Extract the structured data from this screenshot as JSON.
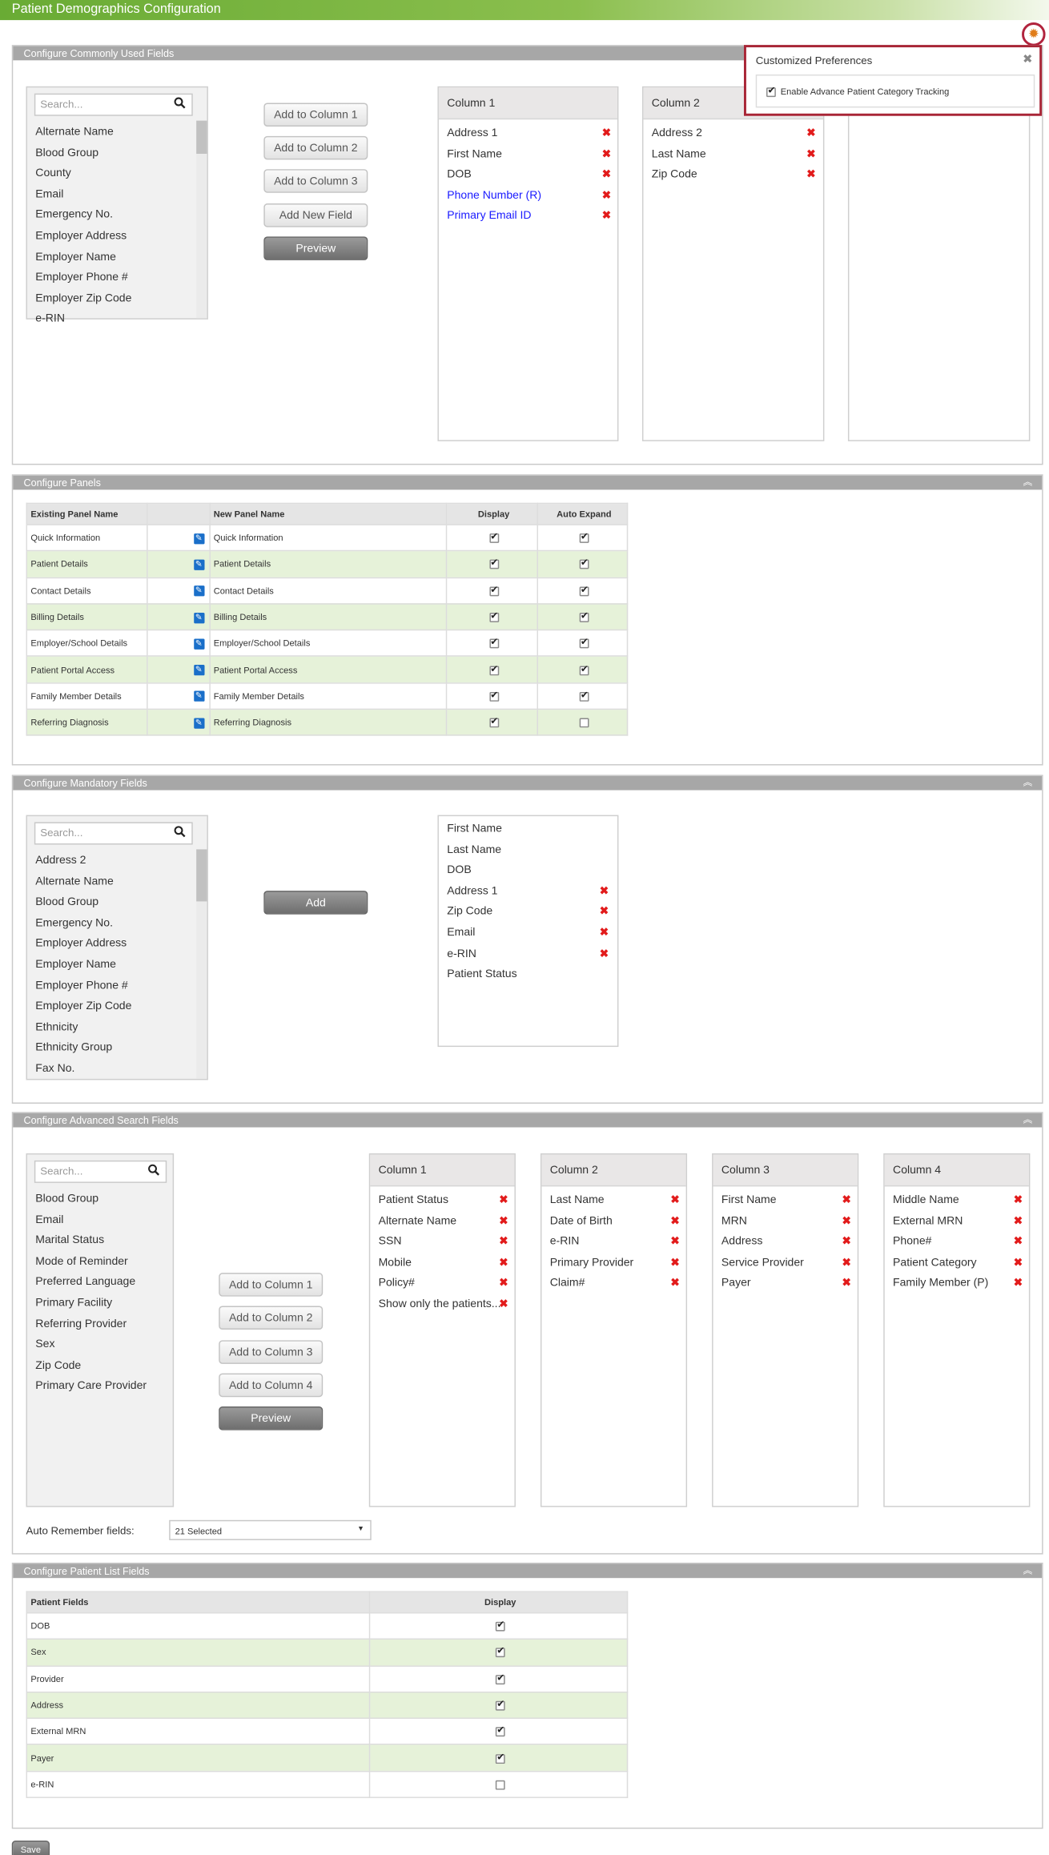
{
  "page_title": "Patient Demographics Configuration",
  "preferences": {
    "title": "Customized Preferences",
    "option": "Enable Advance Patient Category Tracking",
    "checked": true
  },
  "common": {
    "title": "Configure Commonly Used Fields",
    "search_placeholder": "Search...",
    "list": [
      "Alternate Name",
      "Blood Group",
      "County",
      "Email",
      "Emergency No.",
      "Employer Address",
      "Employer Name",
      "Employer Phone #",
      "Employer Zip Code",
      "e-RIN"
    ],
    "buttons": [
      "Add to Column 1",
      "Add to Column 2",
      "Add to Column 3",
      "Add New Field",
      "Preview"
    ],
    "col1": {
      "title": "Column 1",
      "items": [
        "Address 1",
        "First Name",
        "DOB",
        "Phone Number (R)",
        "Primary Email ID"
      ]
    },
    "col2": {
      "title": "Column 2",
      "items": [
        "Address 2",
        "Last Name",
        "Zip Code"
      ]
    }
  },
  "panels": {
    "title": "Configure Panels",
    "headers": [
      "Existing Panel Name",
      "New Panel Name",
      "Display",
      "Auto Expand"
    ],
    "rows": [
      {
        "existing": "Quick Information",
        "new": "Quick Information",
        "display": true,
        "auto": true
      },
      {
        "existing": "Patient Details",
        "new": "Patient Details",
        "display": true,
        "auto": true
      },
      {
        "existing": "Contact Details",
        "new": "Contact Details",
        "display": true,
        "auto": true
      },
      {
        "existing": "Billing Details",
        "new": "Billing Details",
        "display": true,
        "auto": true
      },
      {
        "existing": "Employer/School Details",
        "new": "Employer/School Details",
        "display": true,
        "auto": true
      },
      {
        "existing": "Patient Portal Access",
        "new": "Patient Portal Access",
        "display": true,
        "auto": true
      },
      {
        "existing": "Family Member Details",
        "new": "Family Member Details",
        "display": true,
        "auto": true
      },
      {
        "existing": "Referring Diagnosis",
        "new": "Referring Diagnosis",
        "display": true,
        "auto": false
      }
    ]
  },
  "mandatory": {
    "title": "Configure Mandatory Fields",
    "search_placeholder": "Search...",
    "list": [
      "Address 2",
      "Alternate Name",
      "Blood Group",
      "Emergency No.",
      "Employer Address",
      "Employer Name",
      "Employer Phone #",
      "Employer Zip Code",
      "Ethnicity",
      "Ethnicity Group",
      "Fax No."
    ],
    "add_label": "Add",
    "selected": [
      {
        "name": "First Name",
        "x": false
      },
      {
        "name": "Last Name",
        "x": false
      },
      {
        "name": "DOB",
        "x": false
      },
      {
        "name": "Address 1",
        "x": true
      },
      {
        "name": "Zip Code",
        "x": true
      },
      {
        "name": "Email",
        "x": true
      },
      {
        "name": "e-RIN",
        "x": true
      },
      {
        "name": "Patient Status",
        "x": false
      }
    ]
  },
  "advanced": {
    "title": "Configure Advanced Search Fields",
    "search_placeholder": "Search...",
    "list": [
      "Blood Group",
      "Email",
      "Marital Status",
      "Mode of Reminder",
      "Preferred Language",
      "Primary Facility",
      "Referring Provider",
      "Sex",
      "Zip Code",
      "Primary Care Provider"
    ],
    "buttons": [
      "Add to Column 1",
      "Add to Column 2",
      "Add to Column 3",
      "Add to Column 4",
      "Preview"
    ],
    "columns": [
      {
        "title": "Column 1",
        "items": [
          "Patient Status",
          "Alternate Name",
          "SSN",
          "Mobile",
          "Policy#",
          "Show only the patients..."
        ]
      },
      {
        "title": "Column 2",
        "items": [
          "Last Name",
          "Date of Birth",
          "e-RIN",
          "Primary Provider",
          "Claim#"
        ]
      },
      {
        "title": "Column 3",
        "items": [
          "First Name",
          "MRN",
          "Address",
          "Service Provider",
          "Payer"
        ]
      },
      {
        "title": "Column 4",
        "items": [
          "Middle Name",
          "External MRN",
          "Phone#",
          "Patient Category",
          "Family Member (P)"
        ]
      }
    ],
    "auto_label": "Auto Remember fields:",
    "auto_value": "21 Selected"
  },
  "patient_list": {
    "title": "Configure Patient List Fields",
    "headers": [
      "Patient Fields",
      "Display"
    ],
    "rows": [
      {
        "name": "DOB",
        "display": true
      },
      {
        "name": "Sex",
        "display": true
      },
      {
        "name": "Provider",
        "display": true
      },
      {
        "name": "Address",
        "display": true
      },
      {
        "name": "External MRN",
        "display": true
      },
      {
        "name": "Payer",
        "display": true
      },
      {
        "name": "e-RIN",
        "display": false
      }
    ]
  },
  "save_label": "Save",
  "colors": {
    "accent_green": "#69ab34",
    "remove_red": "#e21b1b",
    "highlight_border": "#a82536",
    "row_alt": "#e6f2d9",
    "link_blue": "#1a1aff"
  }
}
